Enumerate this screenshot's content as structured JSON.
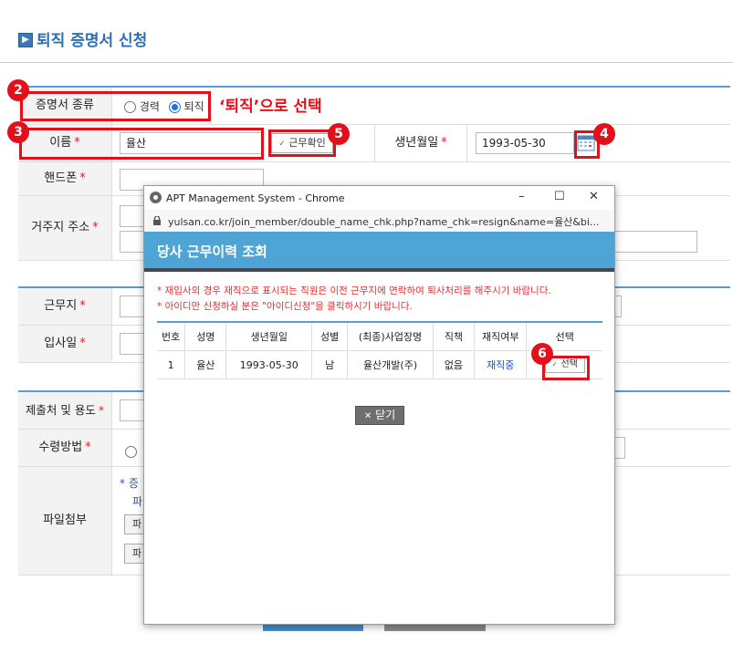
{
  "page": {
    "title": "퇴직 증명서 신청",
    "title_icon": "chevron-right-icon"
  },
  "form": {
    "cert_type_label": "증명서 종류",
    "cert_options": [
      {
        "label": "경력",
        "selected": false
      },
      {
        "label": "퇴직",
        "selected": true
      }
    ],
    "name_label": "이름",
    "name_value": "율산",
    "work_check_button": "근무확인",
    "birth_label": "생년월일",
    "birth_value": "1993-05-30",
    "phone_label": "핸드폰",
    "address_label": "거주지 주소",
    "workplace_label": "근무지",
    "join_date_label": "입사일",
    "submit_to_label": "제출처 및 용도",
    "receive_method_label": "수령방법",
    "attach_label": "파일첨부",
    "attach_note_fragment": "* 증",
    "attach_file_fragment": "파",
    "file_button_fragment": "파",
    "required_mark": "*"
  },
  "annotations": {
    "badge_2": "2",
    "badge_3": "3",
    "badge_4": "4",
    "badge_5": "5",
    "badge_6": "6",
    "retire_callout": "‘퇴직’으로 선택"
  },
  "popup": {
    "window_title": "APT Management System - Chrome",
    "window_controls": [
      "–",
      "☐",
      "✕"
    ],
    "url": "yulsan.co.kr/join_member/double_name_chk.php?name_chk=resign&name=율산&bi...",
    "header": "당사 근무이력 조회",
    "notices": [
      "* 재입사의 경우 재직으로 표시되는 직원은 이전 근무지에 연락하여 퇴사처리를 해주시기 바랍니다.",
      "* 아이디만 신청하실 분은 \"아이디신청\"을 클릭하시기 바랍니다."
    ],
    "table": {
      "headers": [
        "번호",
        "성명",
        "생년월일",
        "성별",
        "(최종)사업장명",
        "직책",
        "재직여부",
        "선택"
      ],
      "rows": [
        [
          "1",
          "율산",
          "1993-05-30",
          "남",
          "율산개발(주)",
          "없음",
          "재직중",
          "선택"
        ]
      ]
    },
    "close_button": "닫기"
  },
  "colors": {
    "accent": "#2d6fb0",
    "section_line": "#5a9bd5",
    "popup_header": "#4ea4d4",
    "annotation_red": "#e3101a",
    "status_link": "#1a4fcf"
  }
}
